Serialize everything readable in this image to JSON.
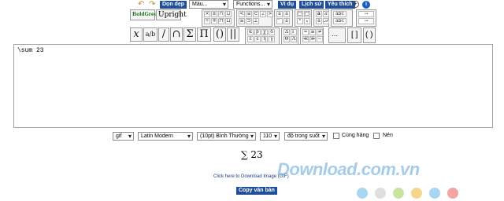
{
  "toolbar": {
    "clear_label": "Dọn dẹp",
    "color_select": "Màu...",
    "functions_select": "Functions...",
    "example_label": "Ví dụ",
    "history_label": "Lịch sử",
    "favorites_label": "Yêu thích",
    "bold_green_label": "BoldGreen",
    "upright_label": "Upright",
    "big_symbols": [
      "x",
      "a/b",
      "/",
      "∩",
      "Σ",
      "Π",
      "()",
      "||"
    ]
  },
  "editor": {
    "content": "\\sum 23"
  },
  "options": {
    "format_select": "gif",
    "font_select": "Latin Modern",
    "size_select": "(10pt) Bình Thường",
    "dpi_select": "110",
    "transparency_select": "độ trong suốt",
    "inline_label": "Cùng hàng",
    "compress_label": "Nén"
  },
  "output": {
    "formula": "∑ 23",
    "download_link": "Click here to Download Image (GIF)",
    "copy_button": "Copy văn bản"
  },
  "watermark": {
    "text": "Download.com.vn"
  },
  "colors": {
    "button_blue": "#1f4e9c",
    "link_blue": "#1f3c8c",
    "dots": [
      "#a9d6f2",
      "#dedede",
      "#c9e3a2",
      "#f6d58c",
      "#a9d6f2",
      "#f4a3a6"
    ]
  }
}
